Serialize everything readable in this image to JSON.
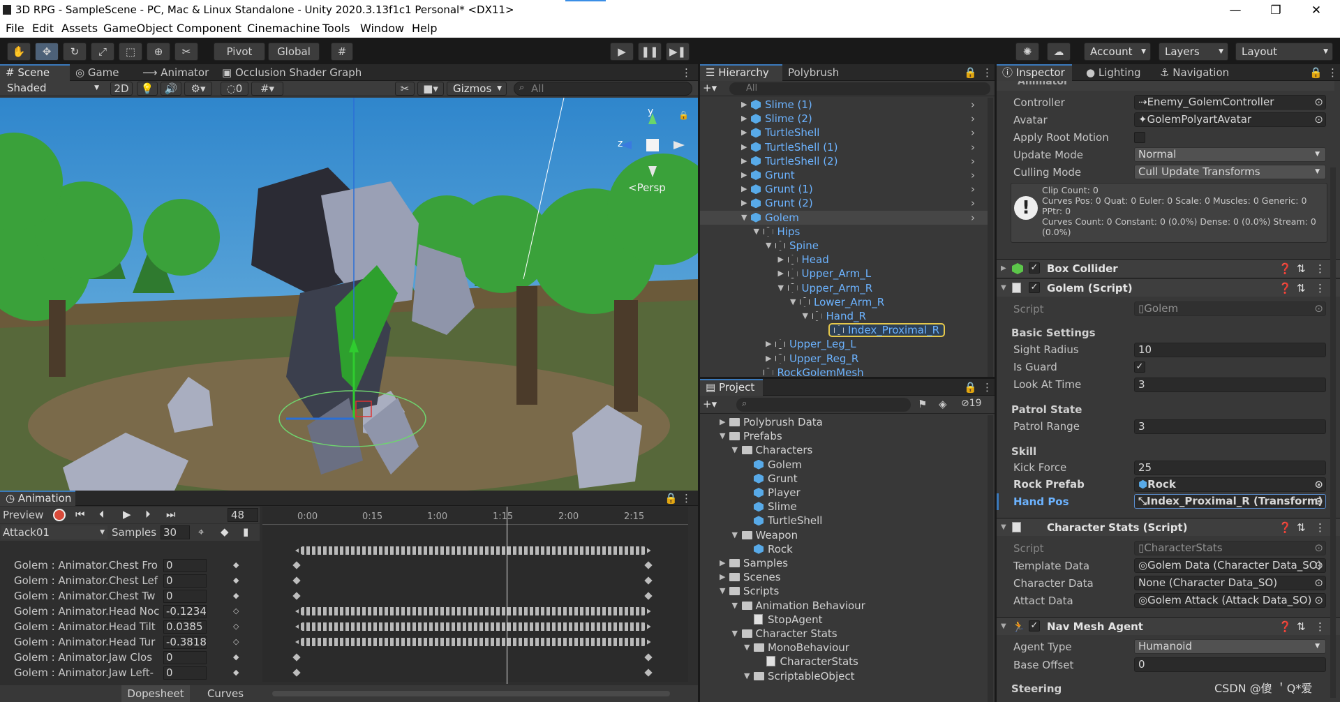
{
  "window": {
    "title": "3D RPG - SampleScene - PC, Mac & Linux Standalone - Unity 2020.3.13f1c1 Personal* <DX11>",
    "controls": [
      "—",
      "❐",
      "✕"
    ]
  },
  "menu": [
    "File",
    "Edit",
    "Assets",
    "GameObject",
    "Component",
    "Cinemachine",
    "Tools",
    "Window",
    "Help"
  ],
  "toolbar": {
    "pivot": "Pivot",
    "global": "Global",
    "account": "Account",
    "layers": "Layers",
    "layout": "Layout"
  },
  "scene_panel": {
    "tabs": [
      "Scene",
      "Game",
      "Animator",
      "Occlusion Shader Graph"
    ],
    "shading": "Shaded",
    "mode_2d": "2D",
    "hidden_count": "0",
    "gizmos": "Gizmos",
    "search_placeholder": "All",
    "persp": "<Persp",
    "axis_y": "y",
    "axis_z": "z"
  },
  "animation_panel": {
    "tab": "Animation",
    "preview": "Preview",
    "frame": "48",
    "clip": "Attack01",
    "samples_label": "Samples",
    "samples": "30",
    "timeline_ticks": [
      "0:00",
      "0:15",
      "1:00",
      "1:15",
      "2:00",
      "2:15"
    ],
    "properties": [
      {
        "name": "Golem : Animator.Chest Fro",
        "value": "0"
      },
      {
        "name": "Golem : Animator.Chest Lef",
        "value": "0"
      },
      {
        "name": "Golem : Animator.Chest Tw",
        "value": "0"
      },
      {
        "name": "Golem : Animator.Head Noc",
        "value": "-0.1234"
      },
      {
        "name": "Golem : Animator.Head Tilt",
        "value": "0.0385"
      },
      {
        "name": "Golem : Animator.Head Tur",
        "value": "-0.3818"
      },
      {
        "name": "Golem : Animator.Jaw Clos",
        "value": "0"
      },
      {
        "name": "Golem : Animator.Jaw Left-",
        "value": "0"
      }
    ],
    "bottom_tabs": [
      "Dopesheet",
      "Curves"
    ]
  },
  "hierarchy": {
    "tabs": [
      "Hierarchy",
      "Polybrush"
    ],
    "search_placeholder": "All",
    "items": [
      {
        "label": "Slime (1)",
        "depth": 0,
        "arrow": "▶",
        "icon": "prefab"
      },
      {
        "label": "Slime (2)",
        "depth": 0,
        "arrow": "▶",
        "icon": "prefab"
      },
      {
        "label": "TurtleShell",
        "depth": 0,
        "arrow": "▶",
        "icon": "prefab"
      },
      {
        "label": "TurtleShell (1)",
        "depth": 0,
        "arrow": "▶",
        "icon": "prefab"
      },
      {
        "label": "TurtleShell (2)",
        "depth": 0,
        "arrow": "▶",
        "icon": "prefab"
      },
      {
        "label": "Grunt",
        "depth": 0,
        "arrow": "▶",
        "icon": "prefab"
      },
      {
        "label": "Grunt (1)",
        "depth": 0,
        "arrow": "▶",
        "icon": "prefab"
      },
      {
        "label": "Grunt (2)",
        "depth": 0,
        "arrow": "▶",
        "icon": "prefab"
      },
      {
        "label": "Golem",
        "depth": 0,
        "arrow": "▼",
        "icon": "prefab"
      },
      {
        "label": "Hips",
        "depth": 1,
        "arrow": "▼",
        "icon": "object"
      },
      {
        "label": "Spine",
        "depth": 2,
        "arrow": "▼",
        "icon": "object"
      },
      {
        "label": "Head",
        "depth": 3,
        "arrow": "▶",
        "icon": "object"
      },
      {
        "label": "Upper_Arm_L",
        "depth": 3,
        "arrow": "▶",
        "icon": "object"
      },
      {
        "label": "Upper_Arm_R",
        "depth": 3,
        "arrow": "▼",
        "icon": "object"
      },
      {
        "label": "Lower_Arm_R",
        "depth": 4,
        "arrow": "▼",
        "icon": "object"
      },
      {
        "label": "Hand_R",
        "depth": 5,
        "arrow": "▼",
        "icon": "object"
      },
      {
        "label": "Index_Proximal_R",
        "depth": 6,
        "arrow": "",
        "icon": "object"
      },
      {
        "label": "Upper_Leg_L",
        "depth": 2,
        "arrow": "▶",
        "icon": "object"
      },
      {
        "label": "Upper_Reg_R",
        "depth": 2,
        "arrow": "▶",
        "icon": "object"
      },
      {
        "label": "RockGolemMesh",
        "depth": 1,
        "arrow": "",
        "icon": "object"
      }
    ]
  },
  "project": {
    "tab": "Project",
    "hidden_count": "19",
    "items": [
      {
        "label": "Polybrush Data",
        "depth": 0,
        "arrow": "▶",
        "icon": "folder"
      },
      {
        "label": "Prefabs",
        "depth": 0,
        "arrow": "▼",
        "icon": "folder"
      },
      {
        "label": "Characters",
        "depth": 1,
        "arrow": "▼",
        "icon": "folder"
      },
      {
        "label": "Golem",
        "depth": 2,
        "arrow": "",
        "icon": "prefab"
      },
      {
        "label": "Grunt",
        "depth": 2,
        "arrow": "",
        "icon": "prefab"
      },
      {
        "label": "Player",
        "depth": 2,
        "arrow": "",
        "icon": "prefab"
      },
      {
        "label": "Slime",
        "depth": 2,
        "arrow": "",
        "icon": "prefab"
      },
      {
        "label": "TurtleShell",
        "depth": 2,
        "arrow": "",
        "icon": "prefab"
      },
      {
        "label": "Weapon",
        "depth": 1,
        "arrow": "▼",
        "icon": "folder"
      },
      {
        "label": "Rock",
        "depth": 2,
        "arrow": "",
        "icon": "prefab"
      },
      {
        "label": "Samples",
        "depth": 0,
        "arrow": "▶",
        "icon": "folder"
      },
      {
        "label": "Scenes",
        "depth": 0,
        "arrow": "▶",
        "icon": "folder"
      },
      {
        "label": "Scripts",
        "depth": 0,
        "arrow": "▼",
        "icon": "folder"
      },
      {
        "label": "Animation Behaviour",
        "depth": 1,
        "arrow": "▼",
        "icon": "folder"
      },
      {
        "label": "StopAgent",
        "depth": 2,
        "arrow": "",
        "icon": "script"
      },
      {
        "label": "Character Stats",
        "depth": 1,
        "arrow": "▼",
        "icon": "folder"
      },
      {
        "label": "MonoBehaviour",
        "depth": 2,
        "arrow": "▼",
        "icon": "folder"
      },
      {
        "label": "CharacterStats",
        "depth": 3,
        "arrow": "",
        "icon": "script"
      },
      {
        "label": "ScriptableObject",
        "depth": 2,
        "arrow": "▼",
        "icon": "folder"
      }
    ]
  },
  "inspector": {
    "tabs": [
      "Inspector",
      "Lighting",
      "Navigation"
    ],
    "animator": {
      "title": "Animator",
      "controller_label": "Controller",
      "controller": "Enemy_GolemController",
      "avatar_label": "Avatar",
      "avatar": "GolemPolyartAvatar",
      "root_motion_label": "Apply Root Motion",
      "update_mode_label": "Update Mode",
      "update_mode": "Normal",
      "culling_label": "Culling Mode",
      "culling": "Cull Update Transforms",
      "info": [
        "Clip Count: 0",
        "Curves Pos: 0 Quat: 0 Euler: 0 Scale: 0 Muscles: 0 Generic: 0",
        "PPtr: 0",
        "Curves Count: 0 Constant: 0 (0.0%) Dense: 0 (0.0%) Stream: 0",
        "(0.0%)"
      ]
    },
    "box_collider": "Box Collider",
    "golem_script": {
      "title": "Golem (Script)",
      "script_label": "Script",
      "script": "Golem",
      "basic_settings": "Basic Settings",
      "sight_label": "Sight Radius",
      "sight": "10",
      "guard_label": "Is Guard",
      "look_label": "Look At Time",
      "look": "3",
      "patrol_state": "Patrol State",
      "patrol_label": "Patrol Range",
      "patrol": "3",
      "skill": "Skill",
      "kick_label": "Kick Force",
      "kick": "25",
      "rock_label": "Rock Prefab",
      "rock": "Rock",
      "hand_label": "Hand Pos",
      "hand": "Index_Proximal_R (Transform)"
    },
    "character_stats": {
      "title": "Character Stats (Script)",
      "script_label": "Script",
      "script": "CharacterStats",
      "template_label": "Template Data",
      "template": "Golem Data (Character Data_SO)",
      "chardata_label": "Character Data",
      "chardata": "None (Character Data_SO)",
      "attack_label": "Attact Data",
      "attack": "Golem Attack (Attack Data_SO)"
    },
    "nav_mesh": {
      "title": "Nav Mesh Agent",
      "agent_type_label": "Agent Type",
      "agent_type": "Humanoid",
      "base_offset_label": "Base Offset",
      "base_offset": "0",
      "steering": "Steering"
    }
  },
  "watermark": "CSDN @傻 ＇Q*爱",
  "colors": {
    "accent": "#3a79bb",
    "link_blue": "#6cb3ff",
    "selection_outline": "#e6c84a"
  }
}
